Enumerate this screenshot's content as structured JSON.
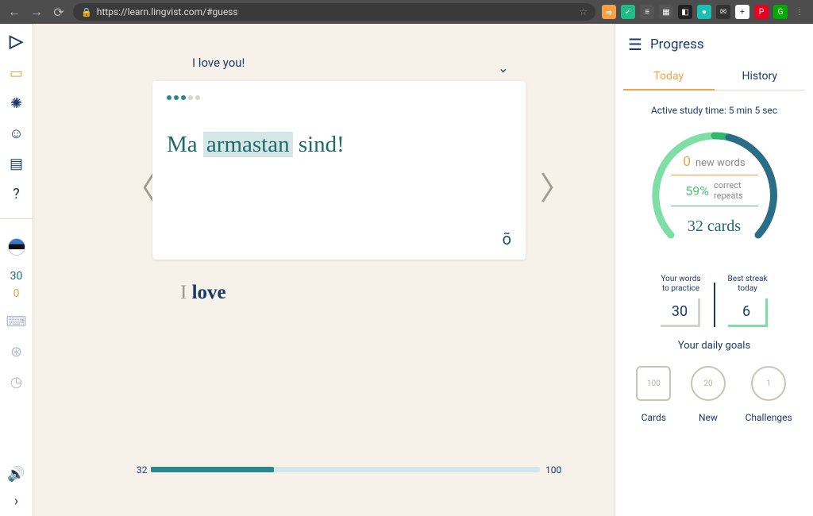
{
  "browser": {
    "url": "https://learn.lingvist.com/#guess"
  },
  "sidebar": {
    "count_blue": "30",
    "count_orange": "0"
  },
  "main": {
    "hint": "I love you!",
    "sentence_pre": "Ma ",
    "sentence_hl": "armastan",
    "sentence_post": " sind!",
    "special_char": "õ",
    "translation_pre": "I ",
    "translation_word": "love",
    "progress_current": "32",
    "progress_total": "100"
  },
  "panel": {
    "title": "Progress",
    "tab_today": "Today",
    "tab_history": "History",
    "study_time": "Active study time: 5 min 5 sec",
    "new_words_n": "0",
    "new_words_lbl": "new words",
    "repeats_pct": "59%",
    "repeats_lbl": "correct\nrepeats",
    "cards": "32 cards",
    "stat1_lbl": "Your words\nto practice",
    "stat1_val": "30",
    "stat2_lbl": "Best streak\ntoday",
    "stat2_val": "6",
    "goals_title": "Your daily goals",
    "goal1_n": "100",
    "goal1_lbl": "Cards",
    "goal2_n": "20",
    "goal2_lbl": "New",
    "goal3_n": "1",
    "goal3_lbl": "Challenges"
  }
}
